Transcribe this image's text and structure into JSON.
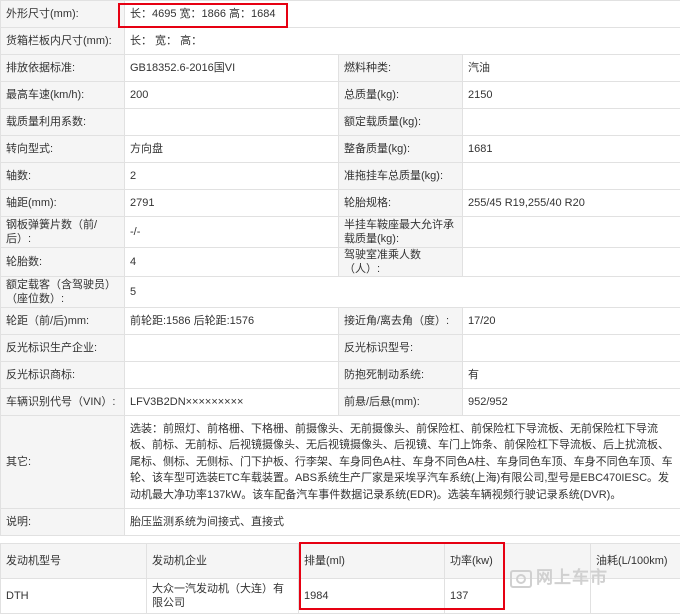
{
  "spec_rows": [
    {
      "k1": "外形尺寸(mm):",
      "v1": "长：4695 宽：1866 高：1684",
      "k2": "",
      "v2": ""
    },
    {
      "k1": "货箱栏板内尺寸(mm):",
      "v1": "长：  宽：  高：",
      "k2": "",
      "v2": ""
    },
    {
      "k1": "排放依据标准:",
      "v1": "GB18352.6-2016国VI",
      "k2": "燃料种类:",
      "v2": "汽油"
    },
    {
      "k1": "最高车速(km/h):",
      "v1": "200",
      "k2": "总质量(kg):",
      "v2": "2150"
    },
    {
      "k1": "载质量利用系数:",
      "v1": "",
      "k2": "额定载质量(kg):",
      "v2": ""
    },
    {
      "k1": "转向型式:",
      "v1": "方向盘",
      "k2": "整备质量(kg):",
      "v2": "1681"
    },
    {
      "k1": "轴数:",
      "v1": "2",
      "k2": "准拖挂车总质量(kg):",
      "v2": ""
    },
    {
      "k1": "轴距(mm):",
      "v1": "2791",
      "k2": "轮胎规格:",
      "v2": "255/45 R19,255/40 R20"
    },
    {
      "k1": "钢板弹簧片数（前/后）:",
      "v1": "-/-",
      "k2": "半挂车鞍座最大允许承载质量(kg):",
      "v2": ""
    },
    {
      "k1": "轮胎数:",
      "v1": "4",
      "k2": "驾驶室准乘人数（人）:",
      "v2": ""
    },
    {
      "k1": "额定载客（含驾驶员）（座位数）:",
      "v1": "5",
      "k2": "",
      "v2": ""
    },
    {
      "k1": "轮距（前/后)mm:",
      "v1": "前轮距:1586 后轮距:1576",
      "k2": "接近角/离去角（度）:",
      "v2": "17/20"
    },
    {
      "k1": "反光标识生产企业:",
      "v1": "",
      "k2": "反光标识型号:",
      "v2": ""
    },
    {
      "k1": "反光标识商标:",
      "v1": "",
      "k2": "防抱死制动系统:",
      "v2": "有"
    },
    {
      "k1": "车辆识别代号（VIN）:",
      "v1": "LFV3B2DN×××××××××",
      "k2": "前悬/后悬(mm):",
      "v2": "952/952"
    },
    {
      "k1": "其它:",
      "v1": "选装：前照灯、前格栅、下格栅、前摄像头、无前摄像头、前保险杠、前保险杠下导流板、无前保险杠下导流板、前标、无前标、后视镜摄像头、无后视镜摄像头、后视镜、车门上饰条、前保险杠下导流板、后上扰流板、尾标、侧标、无侧标、门下护板、行李架、车身同色A柱、车身不同色A柱、车身同色车顶、车身不同色车顶、车轮、该车型可选装ETC车载装置。ABS系统生产厂家是采埃孚汽车系统(上海)有限公司,型号是EBC470IESC。发动机最大净功率137kW。该车配备汽车事件数据记录系统(EDR)。选装车辆视频行驶记录系统(DVR)。",
      "k2": "",
      "v2": ""
    },
    {
      "k1": "说明:",
      "v1": "胎压监测系统为间接式、直接式",
      "k2": "",
      "v2": ""
    }
  ],
  "engine_table": {
    "headers": [
      "发动机型号",
      "发动机企业",
      "排量(ml)",
      "功率(kw)",
      "油耗(L/100km)"
    ],
    "row": [
      "DTH",
      "大众一汽发动机（大连）有限公司",
      "1984",
      "137",
      ""
    ]
  },
  "watermark": "网上车市",
  "highlight_color": "#e60012"
}
